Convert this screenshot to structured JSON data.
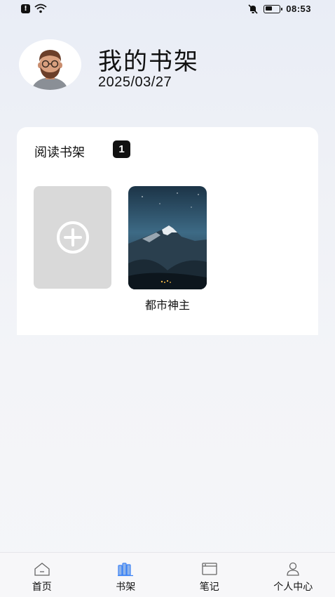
{
  "status_bar": {
    "time": "08:53",
    "icons": [
      "alert-icon",
      "wifi-icon",
      "mute-icon",
      "battery-icon"
    ],
    "battery_level": 0.5
  },
  "header": {
    "title": "我的书架",
    "date": "2025/03/27",
    "avatar_icon": "avatar-icon"
  },
  "shelf": {
    "title": "阅读书架",
    "count": "1",
    "add_icon": "add-circle-icon",
    "books": [
      {
        "title": "都市神主",
        "cover": "mountain-night-cover"
      }
    ]
  },
  "nav": {
    "items": [
      {
        "label": "首页",
        "icon": "home-icon"
      },
      {
        "label": "书架",
        "icon": "bookshelf-icon"
      },
      {
        "label": "笔记",
        "icon": "notes-icon"
      },
      {
        "label": "个人中心",
        "icon": "profile-icon"
      }
    ]
  },
  "colors": {
    "accent": "#3b82f6",
    "background": "#eff1f6",
    "card": "#ffffff",
    "placeholder": "#d9d9d9"
  }
}
